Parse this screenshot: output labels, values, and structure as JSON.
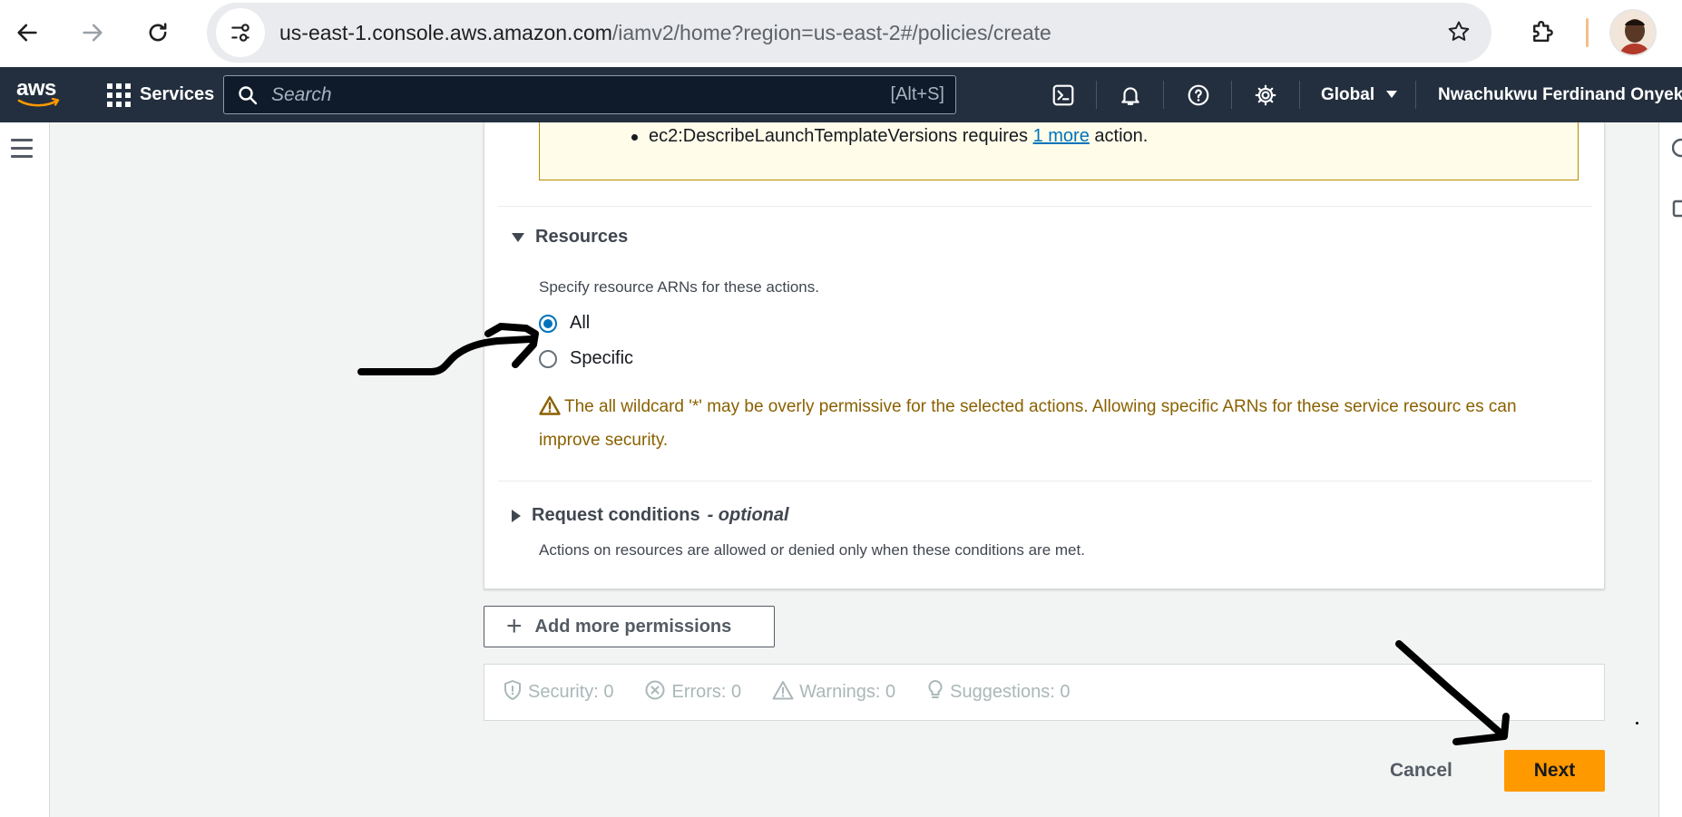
{
  "browser": {
    "url_host": "us-east-1.console.aws.amazon.com",
    "url_path": "/iamv2/home?region=us-east-2#/policies/create"
  },
  "aws_nav": {
    "logo": "aws",
    "services_label": "Services",
    "search_placeholder": "Search",
    "search_shortcut": "[Alt+S]",
    "region_label": "Global",
    "user_name": "Nwachukwu Ferdinand Onyeka"
  },
  "warning_notice": {
    "action_name": "ec2:DescribeLaunchTemplateVersions",
    "requires_text": " requires ",
    "link_text": "1 more",
    "suffix_text": " action."
  },
  "resources": {
    "heading": "Resources",
    "description": "Specify resource ARNs for these actions.",
    "options": [
      {
        "label": "All",
        "selected": true
      },
      {
        "label": "Specific",
        "selected": false
      }
    ],
    "alert_text": "The all wildcard '*' may be overly permissive for the selected actions. Allowing specific ARNs for these service resourc es can improve security."
  },
  "request_conditions": {
    "heading": "Request conditions",
    "optional_label": "- optional",
    "description": "Actions on resources are allowed or denied only when these conditions are met."
  },
  "add_permissions_label": "Add more permissions",
  "validation": {
    "security": "Security: 0",
    "errors": "Errors: 0",
    "warnings": "Warnings: 0",
    "suggestions": "Suggestions: 0"
  },
  "footer": {
    "cancel_label": "Cancel",
    "next_label": "Next"
  },
  "colors": {
    "aws_nav_bg": "#232f3e",
    "primary_button": "#ff9900",
    "link": "#0073bb",
    "warning_text": "#8a6100"
  },
  "icons": [
    "back-arrow-icon",
    "forward-arrow-icon",
    "reload-icon",
    "tune-icon",
    "star-icon",
    "extension-icon",
    "grid-icon",
    "search-icon",
    "cloudshell-icon",
    "bell-icon",
    "help-icon",
    "gear-icon",
    "caret-down-icon",
    "hamburger-icon",
    "warning-icon",
    "plus-icon",
    "shield-icon",
    "error-icon",
    "alert-triangle-icon",
    "lightbulb-icon"
  ]
}
